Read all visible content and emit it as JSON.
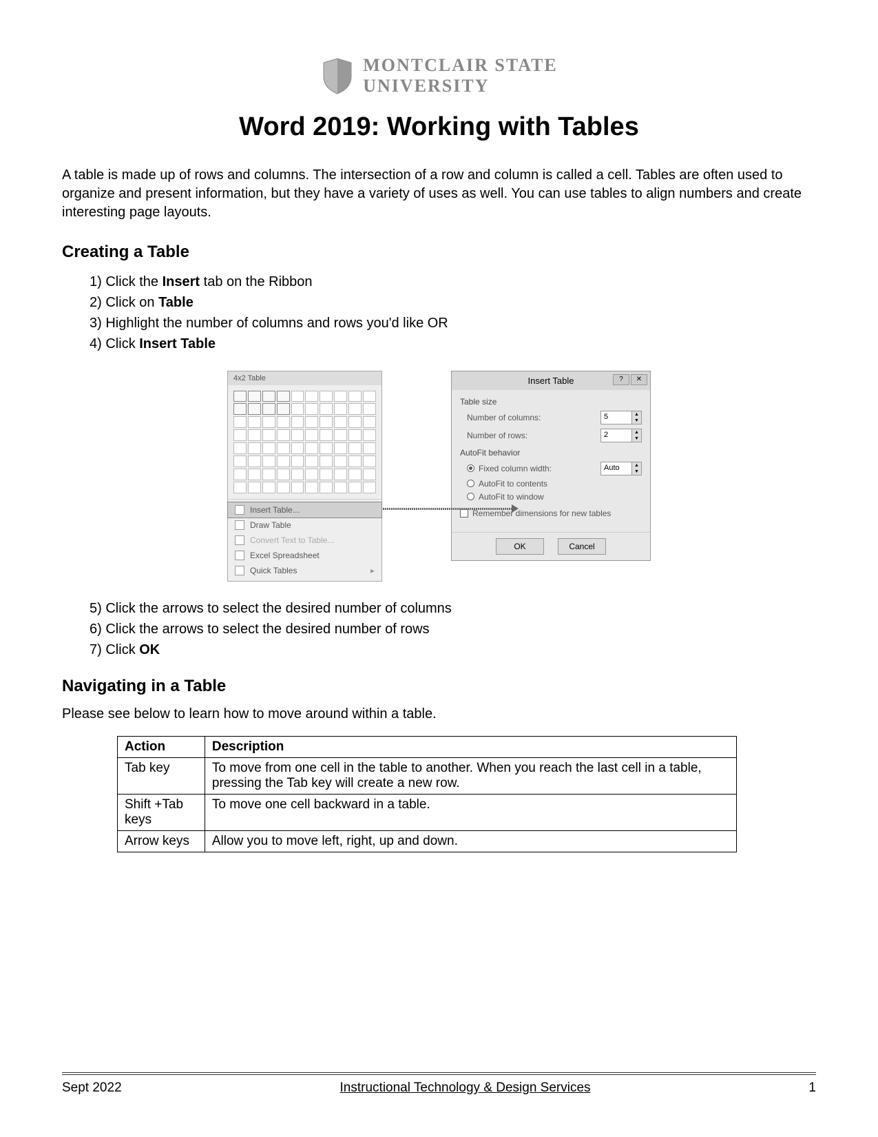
{
  "logo": {
    "line1": "MONTCLAIR STATE",
    "line2": "UNIVERSITY"
  },
  "title": "Word 2019: Working with Tables",
  "intro": "A table is made up of rows and columns. The intersection of a row and column is called a cell. Tables are often used to organize and present information, but they have a variety of uses as well. You can use tables to align numbers and create interesting page layouts.",
  "section1_heading": "Creating a Table",
  "steps1": [
    {
      "num": "1)",
      "text": "Click the ",
      "bold": "Insert",
      "after": " tab on the Ribbon"
    },
    {
      "num": "2)",
      "text": "Click on ",
      "bold": "Table",
      "after": ""
    },
    {
      "num": "3)",
      "text": "Highlight the number of columns and rows you'd like OR",
      "bold": "",
      "after": ""
    },
    {
      "num": "4)",
      "text": "Click ",
      "bold": "Insert Table",
      "after": ""
    }
  ],
  "dropdown": {
    "header": "4x2 Table",
    "items": [
      "Insert Table...",
      "Draw Table",
      "Convert Text to Table...",
      "Excel Spreadsheet",
      "Quick Tables"
    ]
  },
  "dialog": {
    "title": "Insert Table",
    "group1": "Table size",
    "columns_label": "Number of columns:",
    "columns_value": "5",
    "rows_label": "Number of rows:",
    "rows_value": "2",
    "group2": "AutoFit behavior",
    "radio1": "Fixed column width:",
    "radio1_value": "Auto",
    "radio2": "AutoFit to contents",
    "radio3": "AutoFit to window",
    "checkbox": "Remember dimensions for new tables",
    "ok": "OK",
    "cancel": "Cancel"
  },
  "steps2": [
    {
      "num": "5)",
      "text": "Click the arrows to select the desired number of columns"
    },
    {
      "num": "6)",
      "text": "Click the arrows to select the desired number of rows"
    },
    {
      "num": "7)",
      "text": "Click ",
      "bold": "OK"
    }
  ],
  "section2_heading": "Navigating in a Table",
  "nav_intro": "Please see below to learn how to move around within a table.",
  "nav_table": {
    "headers": [
      "Action",
      "Description"
    ],
    "rows": [
      [
        "Tab key",
        "To move from one cell in the table to another. When you reach the last cell in a table, pressing the Tab key will create a new row."
      ],
      [
        "Shift +Tab keys",
        "To move one cell backward in a table."
      ],
      [
        "Arrow keys",
        "Allow you to move left, right, up and down."
      ]
    ]
  },
  "footer": {
    "left": "Sept 2022",
    "center": "Instructional Technology & Design Services",
    "right": "1"
  }
}
